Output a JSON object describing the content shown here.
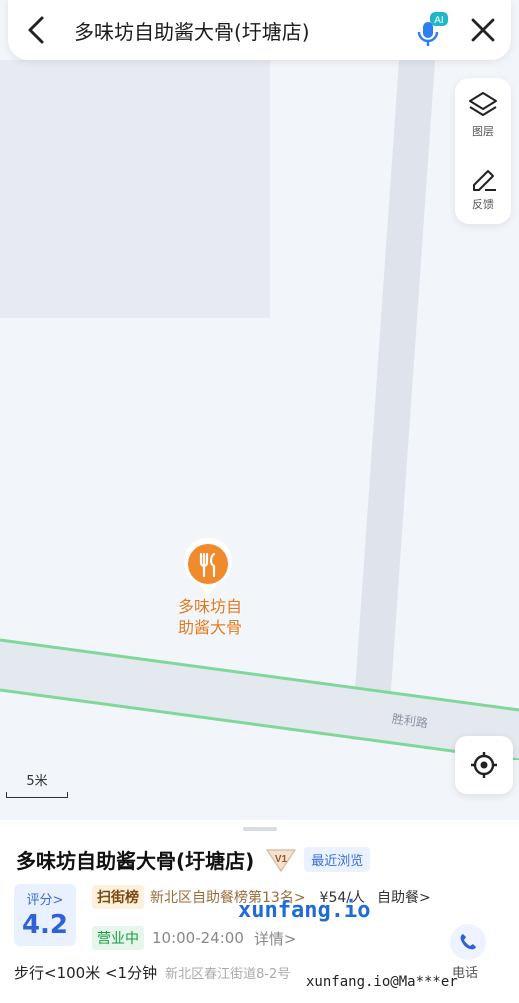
{
  "topbar": {
    "title": "多味坊自助酱大骨(圩塘店)",
    "ai_badge": "AI",
    "icons": [
      "back-arrow-icon",
      "ai-voice-icon",
      "close-icon"
    ]
  },
  "map_tools": {
    "layers_label": "图层",
    "feedback_label": "反馈"
  },
  "map": {
    "poi_name_line1": "多味坊自",
    "poi_name_line2": "助酱大骨",
    "road_name": "胜利路",
    "scale_label": "5米",
    "colors": {
      "pin": "#f08a2c",
      "road_edge": "#7fd89a"
    }
  },
  "poi": {
    "name": "多味坊自助酱大骨(圩塘店)",
    "vip_badge": "V1",
    "recent_tag": "最近浏览",
    "rating_label": "评分>",
    "rating_value": "4.2",
    "rank_tag": "扫街榜",
    "rank_text": "新北区自助餐榜第13名>",
    "price": "¥54/人",
    "category": "自助餐>",
    "status": "营业中",
    "hours": "10:00-24:00",
    "detail_link": "详情>",
    "walk_info": "步行<100米 <1分钟",
    "address": "新北区春江街道8-2号",
    "phone_label": "电话"
  },
  "watermarks": {
    "center": "xunfang.io",
    "corner": "xunfang.io@Ma***er"
  }
}
